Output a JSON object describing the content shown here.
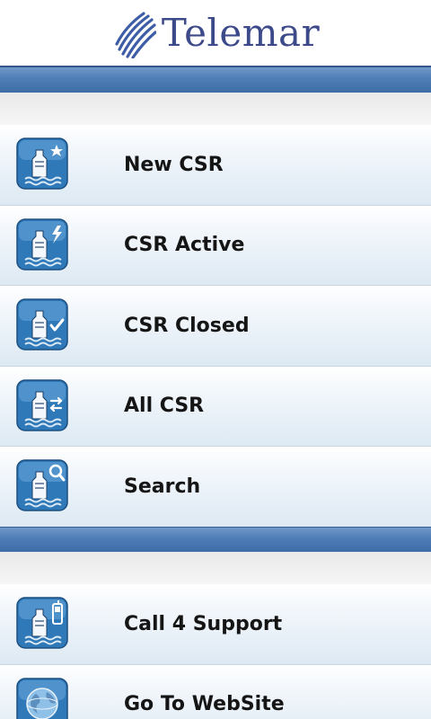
{
  "header": {
    "logo_text": "Telemar"
  },
  "menu_main": [
    {
      "label": "New CSR",
      "icon": "ship-new-icon"
    },
    {
      "label": "CSR Active",
      "icon": "ship-active-icon"
    },
    {
      "label": "CSR Closed",
      "icon": "ship-closed-icon"
    },
    {
      "label": "All CSR",
      "icon": "ship-all-icon"
    },
    {
      "label": "Search",
      "icon": "ship-search-icon"
    }
  ],
  "menu_extra": [
    {
      "label": "Call 4 Support",
      "icon": "ship-phone-icon"
    },
    {
      "label": "Go To WebSite",
      "icon": "globe-icon"
    }
  ],
  "colors": {
    "band": "#4f7db6",
    "logo": "#3d4a8a",
    "icon_bg": "#2f79b8"
  }
}
